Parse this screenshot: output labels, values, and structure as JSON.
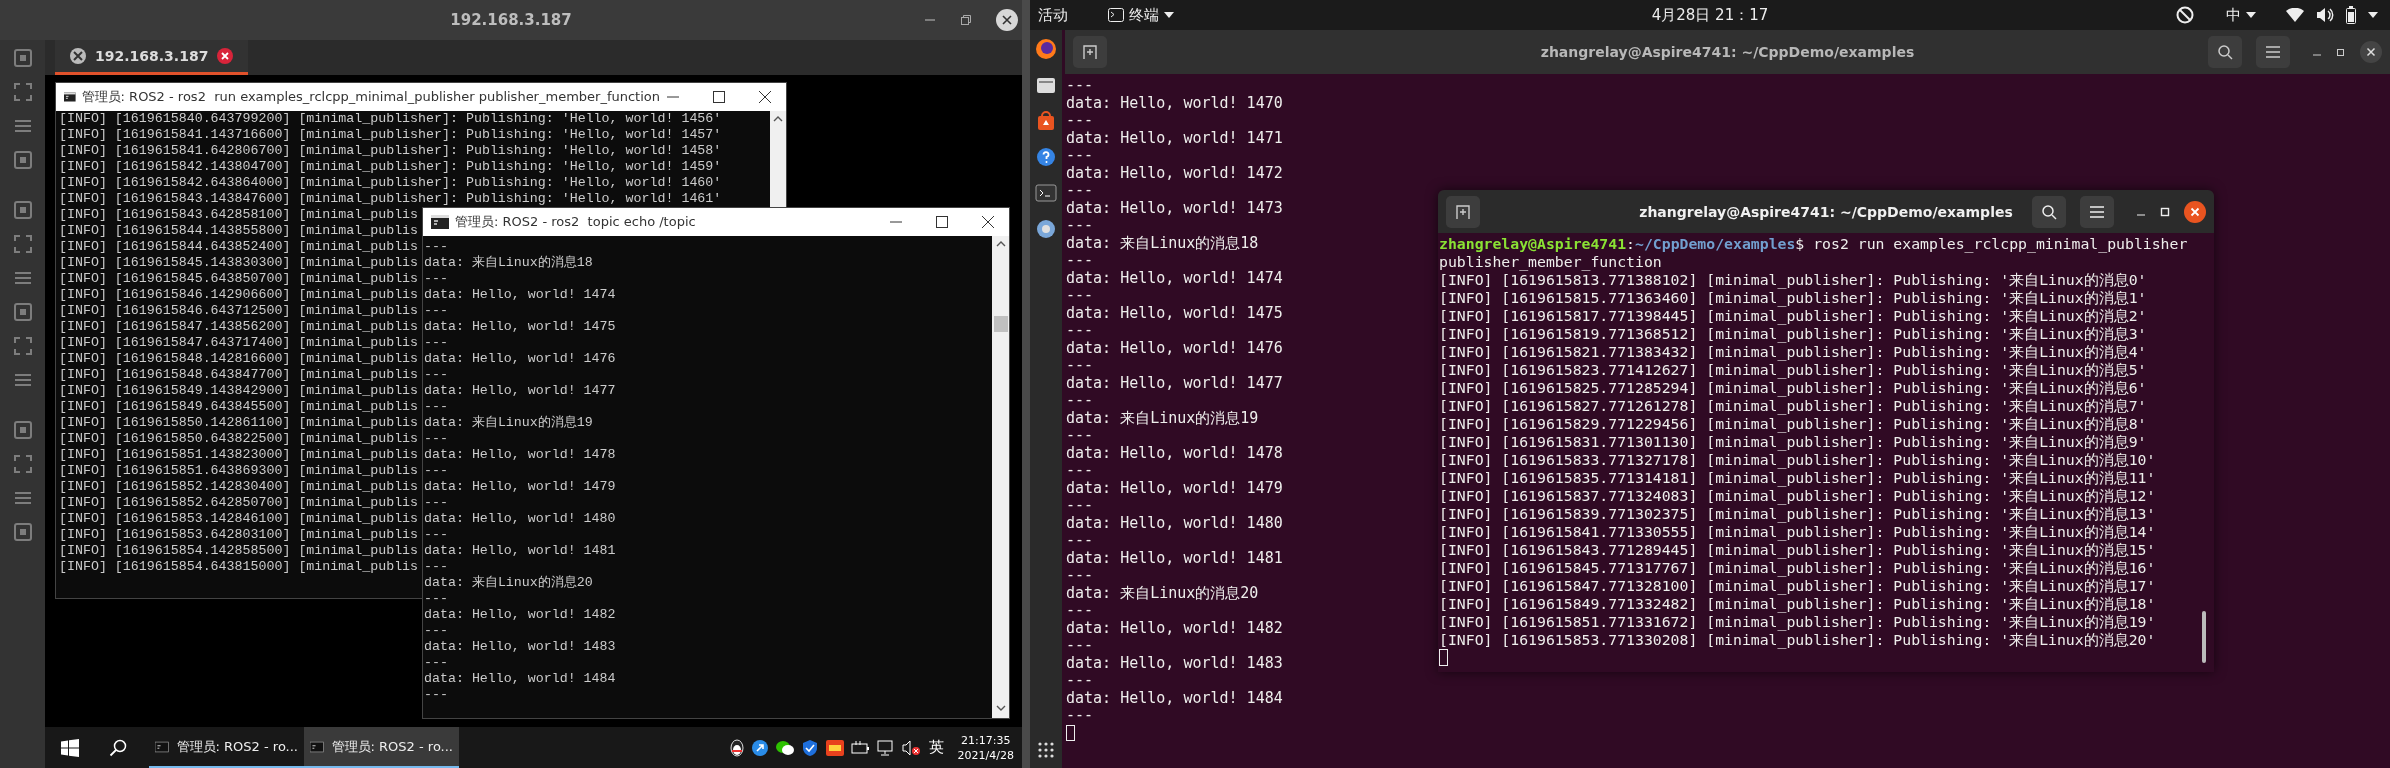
{
  "remote_client": {
    "title": "192.168.3.187",
    "tabs": [
      {
        "label": "192.168.3.187",
        "selected": true
      }
    ],
    "remote_desktop": {
      "windows": [
        {
          "title": "管理员: ROS2 - ros2  run examples_rclcpp_minimal_publisher publisher_member_function",
          "lines": [
            "[INFO] [1619615840.643799200] [minimal_publisher]: Publishing: 'Hello, world! 1456'",
            "[INFO] [1619615841.143716600] [minimal_publisher]: Publishing: 'Hello, world! 1457'",
            "[INFO] [1619615841.642806700] [minimal_publisher]: Publishing: 'Hello, world! 1458'",
            "[INFO] [1619615842.143804700] [minimal_publisher]: Publishing: 'Hello, world! 1459'",
            "[INFO] [1619615842.643864000] [minimal_publisher]: Publishing: 'Hello, world! 1460'",
            "[INFO] [1619615843.143847600] [minimal_publisher]: Publishing: 'Hello, world! 1461'",
            "[INFO] [1619615843.642858100] [minimal_publis",
            "[INFO] [1619615844.143855800] [minimal_publis",
            "[INFO] [1619615844.643852400] [minimal_publis",
            "[INFO] [1619615845.143830300] [minimal_publis",
            "[INFO] [1619615845.643850700] [minimal_publis",
            "[INFO] [1619615846.142906600] [minimal_publis",
            "[INFO] [1619615846.643712500] [minimal_publis",
            "[INFO] [1619615847.143856200] [minimal_publis",
            "[INFO] [1619615847.643717400] [minimal_publis",
            "[INFO] [1619615848.142816600] [minimal_publis",
            "[INFO] [1619615848.643847700] [minimal_publis",
            "[INFO] [1619615849.143842900] [minimal_publis",
            "[INFO] [1619615849.643845500] [minimal_publis",
            "[INFO] [1619615850.142861100] [minimal_publis",
            "[INFO] [1619615850.643822500] [minimal_publis",
            "[INFO] [1619615851.143823000] [minimal_publis",
            "[INFO] [1619615851.643869300] [minimal_publis",
            "[INFO] [1619615852.142830400] [minimal_publis",
            "[INFO] [1619615852.642850700] [minimal_publis",
            "[INFO] [1619615853.142846100] [minimal_publis",
            "[INFO] [1619615853.642803100] [minimal_publis",
            "[INFO] [1619615854.142858500] [minimal_publis",
            "[INFO] [1619615854.643815000] [minimal_publis"
          ]
        },
        {
          "title": "管理员: ROS2 - ros2  topic echo /topic",
          "lines": [
            "---",
            "data: 来自Linux的消息18",
            "---",
            "data: Hello, world! 1474",
            "---",
            "data: Hello, world! 1475",
            "---",
            "data: Hello, world! 1476",
            "---",
            "data: Hello, world! 1477",
            "---",
            "data: 来自Linux的消息19",
            "---",
            "data: Hello, world! 1478",
            "---",
            "data: Hello, world! 1479",
            "---",
            "data: Hello, world! 1480",
            "---",
            "data: Hello, world! 1481",
            "---",
            "data: 来自Linux的消息20",
            "---",
            "data: Hello, world! 1482",
            "---",
            "data: Hello, world! 1483",
            "---",
            "data: Hello, world! 1484",
            "---"
          ]
        }
      ],
      "taskbar": {
        "buttons": [
          {
            "label": "管理员: ROS2 - ro...",
            "selected": false
          },
          {
            "label": "管理员: ROS2 - ro...",
            "selected": true
          }
        ],
        "language": "英",
        "time": "21:17:35",
        "date": "2021/4/28"
      }
    }
  },
  "ubuntu": {
    "top_bar": {
      "activities": "活动",
      "app_menu": "终端",
      "clock": "4月28日 21：17",
      "input_method": "中"
    },
    "terminal": {
      "title": "zhangrelay@Aspire4741: ~/CppDemo/examples",
      "lines": [
        "---",
        "data: Hello, world! 1470",
        "---",
        "data: Hello, world! 1471",
        "---",
        "data: Hello, world! 1472",
        "---",
        "data: Hello, world! 1473",
        "---",
        "data: 来自Linux的消息18",
        "---",
        "data: Hello, world! 1474",
        "---",
        "data: Hello, world! 1475",
        "---",
        "data: Hello, world! 1476",
        "---",
        "data: Hello, world! 1477",
        "---",
        "data: 来自Linux的消息19",
        "---",
        "data: Hello, world! 1478",
        "---",
        "data: Hello, world! 1479",
        "---",
        "data: Hello, world! 1480",
        "---",
        "data: Hello, world! 1481",
        "---",
        "data: 来自Linux的消息20",
        "---",
        "data: Hello, world! 1482",
        "---",
        "data: Hello, world! 1483",
        "---",
        "data: Hello, world! 1484",
        "---"
      ]
    },
    "inner_terminal": {
      "title": "zhangrelay@Aspire4741: ~/CppDemo/examples",
      "prompt": {
        "user": "zhangrelay@Aspire4741",
        "separator": ":",
        "path": "~/CppDemo/examples",
        "command": "$ ros2 run examples_rclcpp_minimal_publisher"
      },
      "command_continuation": "publisher_member_function",
      "lines": [
        "[INFO] [1619615813.771388102] [minimal_publisher]: Publishing: '来自Linux的消息0'",
        "[INFO] [1619615815.771363460] [minimal_publisher]: Publishing: '来自Linux的消息1'",
        "[INFO] [1619615817.771398445] [minimal_publisher]: Publishing: '来自Linux的消息2'",
        "[INFO] [1619615819.771368512] [minimal_publisher]: Publishing: '来自Linux的消息3'",
        "[INFO] [1619615821.771383432] [minimal_publisher]: Publishing: '来自Linux的消息4'",
        "[INFO] [1619615823.771412627] [minimal_publisher]: Publishing: '来自Linux的消息5'",
        "[INFO] [1619615825.771285294] [minimal_publisher]: Publishing: '来自Linux的消息6'",
        "[INFO] [1619615827.771261278] [minimal_publisher]: Publishing: '来自Linux的消息7'",
        "[INFO] [1619615829.771229456] [minimal_publisher]: Publishing: '来自Linux的消息8'",
        "[INFO] [1619615831.771301130] [minimal_publisher]: Publishing: '来自Linux的消息9'",
        "[INFO] [1619615833.771327178] [minimal_publisher]: Publishing: '来自Linux的消息10'",
        "[INFO] [1619615835.771314181] [minimal_publisher]: Publishing: '来自Linux的消息11'",
        "[INFO] [1619615837.771324083] [minimal_publisher]: Publishing: '来自Linux的消息12'",
        "[INFO] [1619615839.771302375] [minimal_publisher]: Publishing: '来自Linux的消息13'",
        "[INFO] [1619615841.771330555] [minimal_publisher]: Publishing: '来自Linux的消息14'",
        "[INFO] [1619615843.771289445] [minimal_publisher]: Publishing: '来自Linux的消息15'",
        "[INFO] [1619615845.771317767] [minimal_publisher]: Publishing: '来自Linux的消息16'",
        "[INFO] [1619615847.771328100] [minimal_publisher]: Publishing: '来自Linux的消息17'",
        "[INFO] [1619615849.771332482] [minimal_publisher]: Publishing: '来自Linux的消息18'",
        "[INFO] [1619615851.771331672] [minimal_publisher]: Publishing: '来自Linux的消息19'",
        "[INFO] [1619615853.771330208] [minimal_publisher]: Publishing: '来自Linux的消息20'"
      ]
    }
  }
}
